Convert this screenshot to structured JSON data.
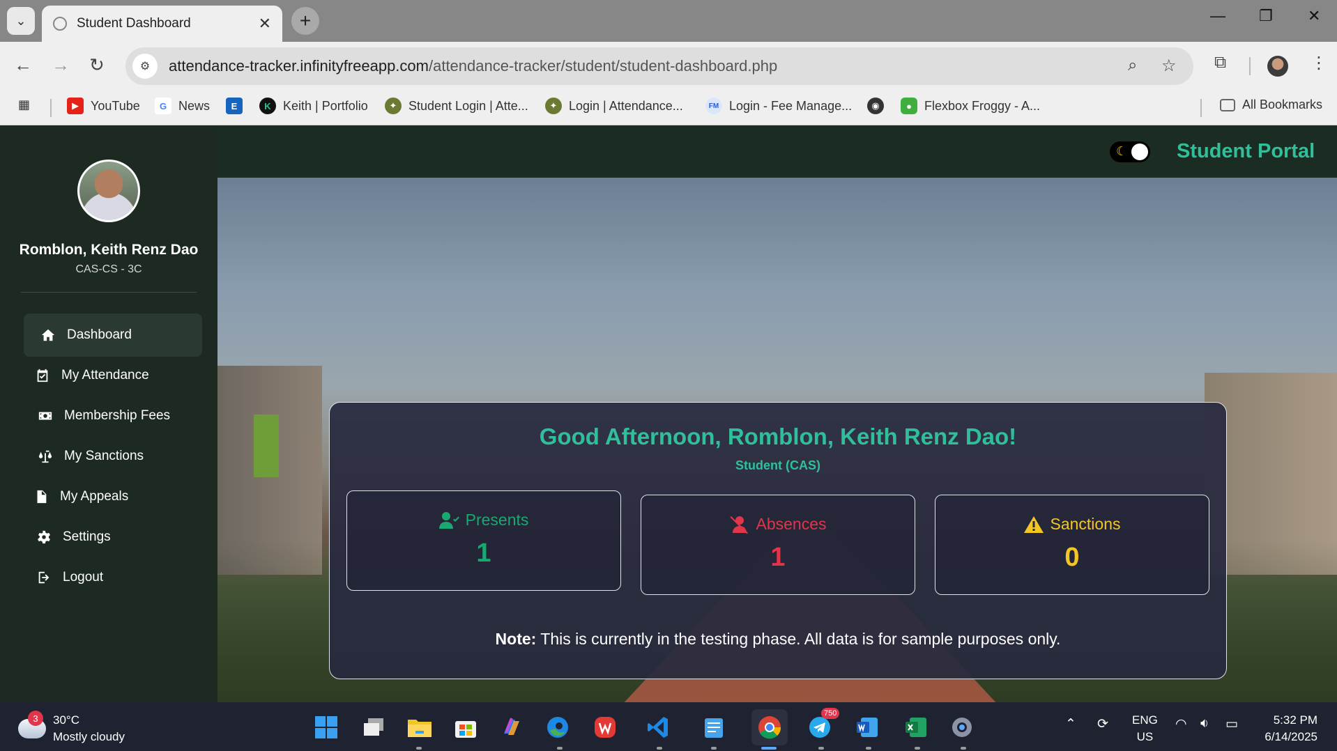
{
  "browser": {
    "tab_title": "Student Dashboard",
    "url_host": "attendance-tracker.infinityfreeapp.com",
    "url_path": "/attendance-tracker/student/student-dashboard.php",
    "bookmarks": [
      "YouTube",
      "News",
      "Keith | Portfolio",
      "Student Login | Atte...",
      "Login | Attendance...",
      "Login - Fee Manage...",
      "Flexbox Froggy - A..."
    ],
    "all_bookmarks": "All Bookmarks"
  },
  "sidebar": {
    "student_name": "Romblon, Keith Renz Dao",
    "course": "CAS-CS - 3C",
    "items": [
      {
        "label": "Dashboard",
        "icon": "home-icon"
      },
      {
        "label": "My Attendance",
        "icon": "calendar-check-icon"
      },
      {
        "label": "Membership Fees",
        "icon": "money-icon"
      },
      {
        "label": "My Sanctions",
        "icon": "scale-icon"
      },
      {
        "label": "My Appeals",
        "icon": "document-icon"
      },
      {
        "label": "Settings",
        "icon": "gear-icon"
      },
      {
        "label": "Logout",
        "icon": "logout-icon"
      }
    ]
  },
  "header": {
    "portal_title": "Student Portal"
  },
  "dashboard": {
    "greeting": "Good Afternoon, Romblon, Keith Renz Dao!",
    "role": "Student (CAS)",
    "stats": {
      "presents": {
        "label": "Presents",
        "value": "1"
      },
      "absences": {
        "label": "Absences",
        "value": "1"
      },
      "sanctions": {
        "label": "Sanctions",
        "value": "0"
      }
    },
    "note_label": "Note:",
    "note_text": " This is currently in the testing phase. All data is for sample purposes only."
  },
  "colors": {
    "accent": "#2fc09b",
    "presents": "#1aa870",
    "absences": "#e0354a",
    "sanctions": "#f3c623"
  },
  "taskbar": {
    "weather_badge": "3",
    "temperature": "30°C",
    "condition": "Mostly cloudy",
    "telegram_badge": "750",
    "lang_top": "ENG",
    "lang_bottom": "US",
    "time": "5:32 PM",
    "date": "6/14/2025"
  }
}
